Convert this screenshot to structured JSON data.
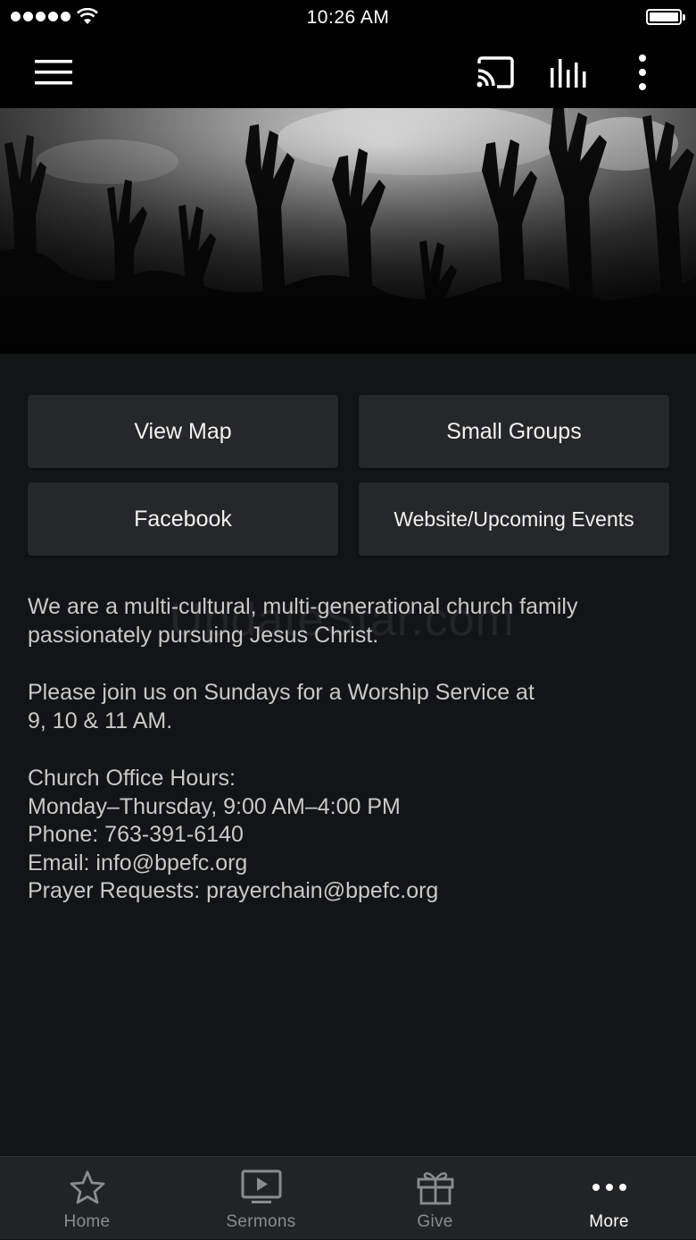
{
  "status_bar": {
    "time": "10:26 AM"
  },
  "toolbar": {
    "menu_icon": "hamburger-menu-icon",
    "cast_icon": "cast-icon",
    "audio_icon": "audio-levels-icon",
    "more_icon": "vertical-dots-icon"
  },
  "hero": {
    "image": "worship-crowd-raised-hands-photo"
  },
  "buttons": [
    {
      "label": "View Map"
    },
    {
      "label": "Small Groups"
    },
    {
      "label": "Facebook"
    },
    {
      "label": "Website/Upcoming Events"
    }
  ],
  "description": {
    "line1": "We are a multi-cultural, multi-generational church family",
    "line2": "passionately pursuing Jesus Christ.",
    "line3": "Please join us on Sundays for a Worship Service at",
    "line4": "9, 10 & 11 AM.",
    "line5": "Church Office Hours:",
    "line6": "Monday–Thursday, 9:00 AM–4:00 PM",
    "line7": "Phone: 763-391-6140",
    "line8": "Email: info@bpefc.org",
    "line9": "Prayer Requests: prayerchain@bpefc.org"
  },
  "watermark": "UpdateStar.com",
  "tabs": [
    {
      "label": "Home",
      "icon": "star-icon"
    },
    {
      "label": "Sermons",
      "icon": "play-screen-icon"
    },
    {
      "label": "Give",
      "icon": "gift-icon"
    },
    {
      "label": "More",
      "icon": "dots-icon",
      "active": true
    }
  ],
  "colors": {
    "background": "#131416",
    "toolbar": "#000000",
    "button": "#262729",
    "tabbar": "#222325",
    "tab_inactive": "#8b8c8f",
    "tab_active": "#ffffff"
  }
}
